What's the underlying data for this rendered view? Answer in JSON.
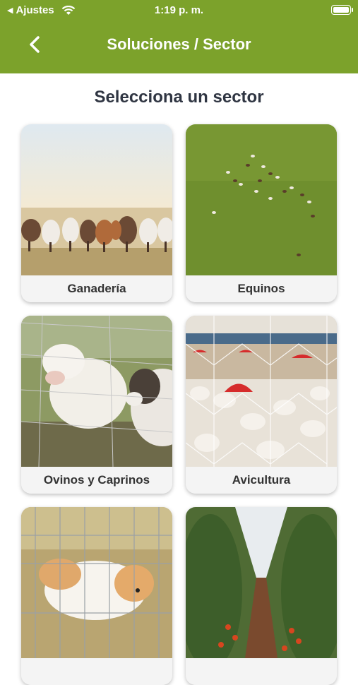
{
  "status_bar": {
    "back_app": "Ajustes",
    "time": "1:19 p. m."
  },
  "header": {
    "title": "Soluciones / Sector"
  },
  "subtitle": "Selecciona un sector",
  "sectors": [
    {
      "label": "Ganadería"
    },
    {
      "label": "Equinos"
    },
    {
      "label": "Ovinos y Caprinos"
    },
    {
      "label": "Avicultura"
    },
    {
      "label": ""
    },
    {
      "label": ""
    }
  ],
  "colors": {
    "header": "#7ca22b",
    "title_text": "#2f3542"
  }
}
